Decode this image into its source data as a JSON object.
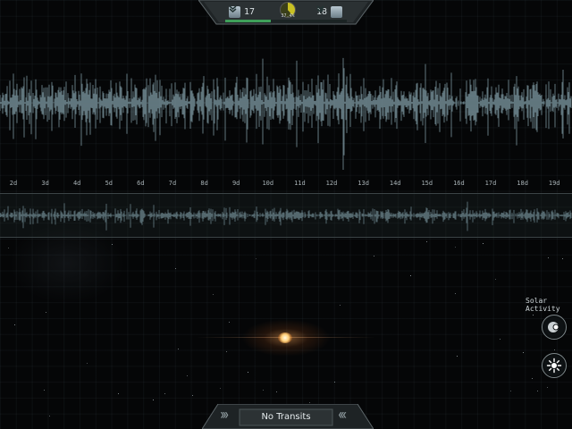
{
  "hud": {
    "left_rank": "17",
    "right_rank": "18",
    "progress_percent": "37.4%",
    "progress_value": 0.374
  },
  "timeline": {
    "day_labels": [
      "2d",
      "3d",
      "4d",
      "5d",
      "6d",
      "7d",
      "8d",
      "9d",
      "10d",
      "11d",
      "12d",
      "13d",
      "14d",
      "15d",
      "16d",
      "17d",
      "18d",
      "19d"
    ]
  },
  "controls": {
    "solar_activity_label": "Solar Activity",
    "activity_icon": "toggle-icon",
    "star_icon": "sun-icon"
  },
  "transit": {
    "status_label": "No Transits"
  },
  "colors": {
    "waveform": "#7e9aa3",
    "accent_green": "#3fa05a",
    "gauge_yellow": "#c8c023",
    "star": "#ffcf7a"
  }
}
